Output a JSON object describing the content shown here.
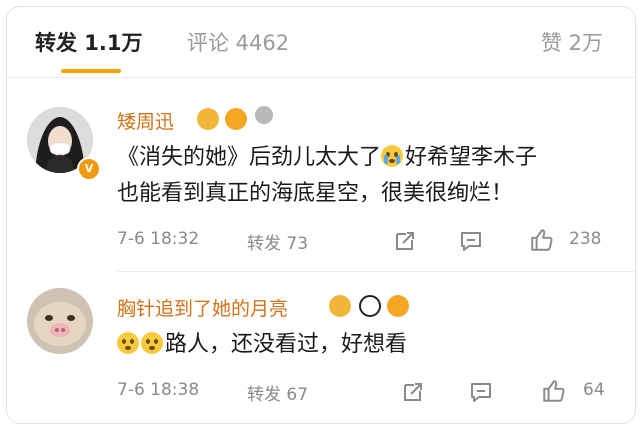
{
  "tabs": {
    "reposts": "转发 1.1万",
    "comments": "评论 4462",
    "likes": "赞 2万",
    "active_color": "#f5a400"
  },
  "comments": [
    {
      "username": "矮周迅",
      "text_line1": "《消失的她》后劲儿太大了",
      "text_line1_after": "好希望李木子",
      "text_line2": "也能看到真正的海底星空，很美很绚烂！",
      "time": "7-6 18:32",
      "repost_label": "转发 73",
      "like_count": "238",
      "verified_badge": "V"
    },
    {
      "username": "胸针追到了她的月亮",
      "text": "路人，还没看过，好想看",
      "time": "7-6 18:38",
      "repost_label": "转发 67",
      "like_count": "64"
    }
  ],
  "icons": [
    "share-icon",
    "comment-icon",
    "like-icon"
  ],
  "colors": {
    "username": "#d2731a",
    "meta": "#8a8a8a",
    "verified": "#f29a0e"
  }
}
